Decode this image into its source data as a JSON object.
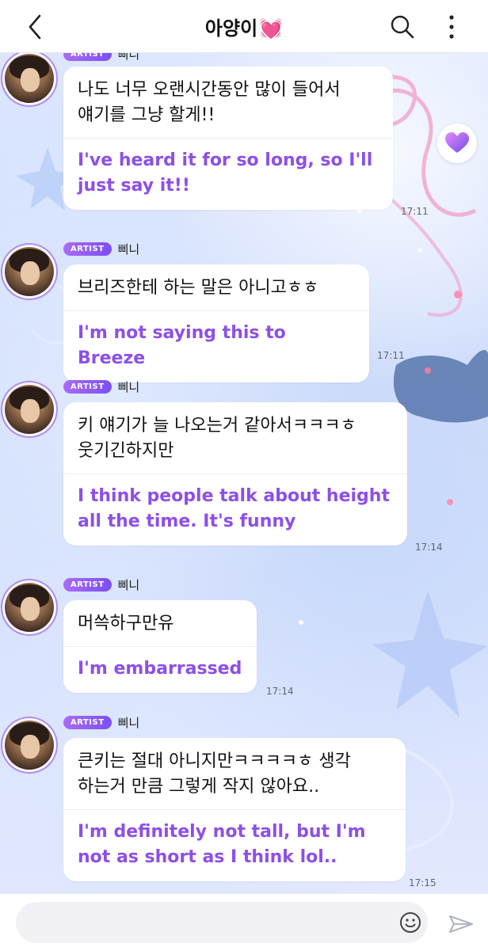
{
  "header": {
    "title": "아양이",
    "title_emoji": "💓",
    "icons": {
      "back": "chevron-left-icon",
      "search": "search-icon",
      "more": "more-vertical-icon"
    }
  },
  "colors": {
    "accent_purple": "#8d4fe8",
    "badge_gradient_start": "#a86cf6",
    "badge_gradient_end": "#7c4ef2",
    "heart_pink": "#f052a8"
  },
  "messages": [
    {
      "badge": "ARTIST",
      "sender": "삐니",
      "korean": "나도 너무 오랜시간동안 많이 들어서\n얘기를 그냥 할게!!",
      "english": "I've heard it for so long, so I'll\njust say it!!",
      "time": "17:11"
    },
    {
      "badge": "ARTIST",
      "sender": "삐니",
      "korean": "브리즈한테 하는 말은 아니고ㅎㅎ",
      "english": "I'm not saying this to Breeze",
      "time": "17:11"
    },
    {
      "badge": "ARTIST",
      "sender": "삐니",
      "korean": "키 얘기가 늘 나오는거 같아서ㅋㅋㅋㅎ\n웃기긴하지만",
      "english": "I think people talk about height\nall the time. It's funny",
      "time": "17:14"
    },
    {
      "badge": "ARTIST",
      "sender": "삐니",
      "korean": "머쓱하구만유",
      "english": "I'm embarrassed",
      "time": "17:14"
    },
    {
      "badge": "ARTIST",
      "sender": "삐니",
      "korean": "큰키는 절대 아니지만ㅋㅋㅋㅋㅎ 생각\n하는거 만큼 그렇게 작지 않아요..",
      "english": "I'm definitely not tall, but I'm\nnot as short as I think lol..",
      "time": "17:15"
    }
  ],
  "input": {
    "placeholder": "",
    "value": ""
  },
  "floating_button": {
    "icon": "purple-heart-icon"
  },
  "input_icons": {
    "emoji": "smiley-icon",
    "send": "paper-plane-icon"
  }
}
